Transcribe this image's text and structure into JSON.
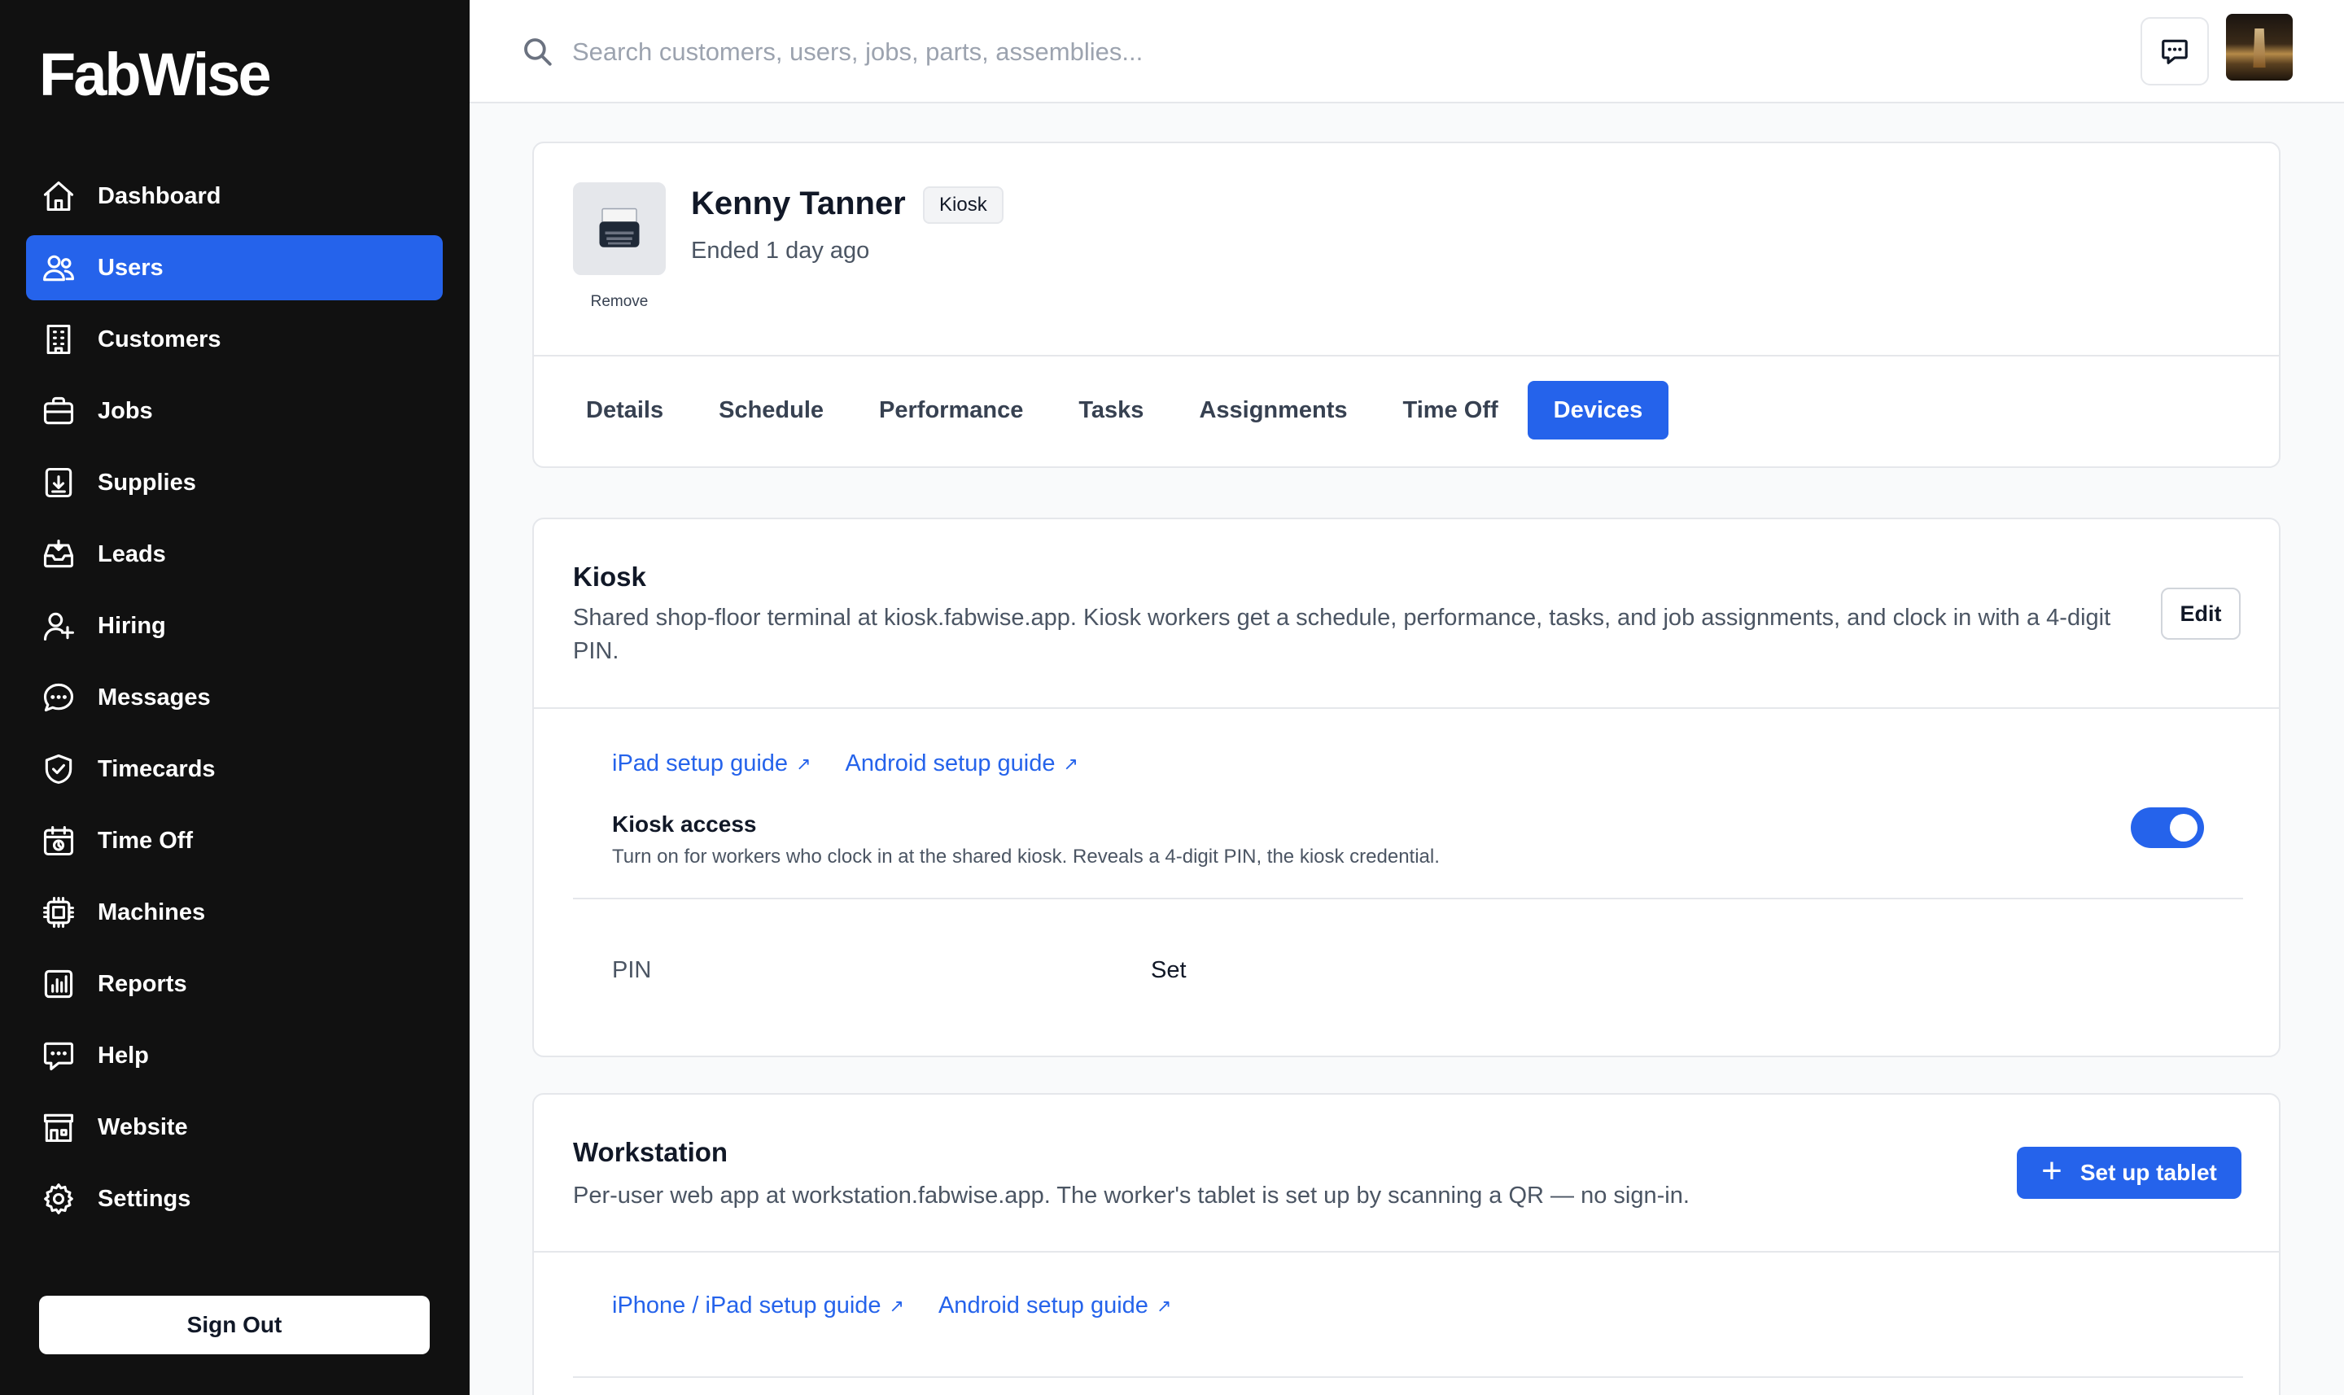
{
  "brand": "FabWise",
  "sidebar": {
    "items": [
      {
        "label": "Dashboard",
        "icon": "home-icon"
      },
      {
        "label": "Users",
        "icon": "users-icon",
        "active": true
      },
      {
        "label": "Customers",
        "icon": "building-icon"
      },
      {
        "label": "Jobs",
        "icon": "briefcase-icon"
      },
      {
        "label": "Supplies",
        "icon": "archive-download-icon"
      },
      {
        "label": "Leads",
        "icon": "inbox-icon"
      },
      {
        "label": "Hiring",
        "icon": "user-plus-icon"
      },
      {
        "label": "Messages",
        "icon": "chat-bubble-icon"
      },
      {
        "label": "Timecards",
        "icon": "shield-check-icon"
      },
      {
        "label": "Time Off",
        "icon": "calendar-clock-icon"
      },
      {
        "label": "Machines",
        "icon": "cpu-chip-icon"
      },
      {
        "label": "Reports",
        "icon": "bar-chart-icon"
      },
      {
        "label": "Help",
        "icon": "chat-dots-icon"
      },
      {
        "label": "Website",
        "icon": "storefront-icon"
      },
      {
        "label": "Settings",
        "icon": "gear-icon"
      }
    ],
    "signout": "Sign Out"
  },
  "topbar": {
    "search_placeholder": "Search customers, users, jobs, parts, assemblies...",
    "search_value": ""
  },
  "profile": {
    "name": "Kenny Tanner",
    "badge": "Kiosk",
    "status": "Ended 1 day ago",
    "remove": "Remove"
  },
  "tabs": [
    {
      "label": "Details"
    },
    {
      "label": "Schedule"
    },
    {
      "label": "Performance"
    },
    {
      "label": "Tasks"
    },
    {
      "label": "Assignments"
    },
    {
      "label": "Time Off"
    },
    {
      "label": "Devices",
      "active": true
    }
  ],
  "kiosk": {
    "title": "Kiosk",
    "description": "Shared shop-floor terminal at kiosk.fabwise.app. Kiosk workers get a schedule, performance, tasks, and job assignments, and clock in with a 4-digit PIN.",
    "edit": "Edit",
    "guides": [
      "iPad setup guide",
      "Android setup guide"
    ],
    "access_label": "Kiosk access",
    "access_help": "Turn on for workers who clock in at the shared kiosk. Reveals a 4-digit PIN, the kiosk credential.",
    "access_on": true,
    "pin_label": "PIN",
    "pin_value": "Set"
  },
  "workstation": {
    "title": "Workstation",
    "description": "Per-user web app at workstation.fabwise.app. The worker's tablet is set up by scanning a QR — no sign-in.",
    "setup_button": "Set up tablet",
    "guides": [
      "iPhone / iPad setup guide",
      "Android setup guide"
    ]
  },
  "colors": {
    "accent": "#2563eb",
    "sidebar_bg": "#111111"
  }
}
